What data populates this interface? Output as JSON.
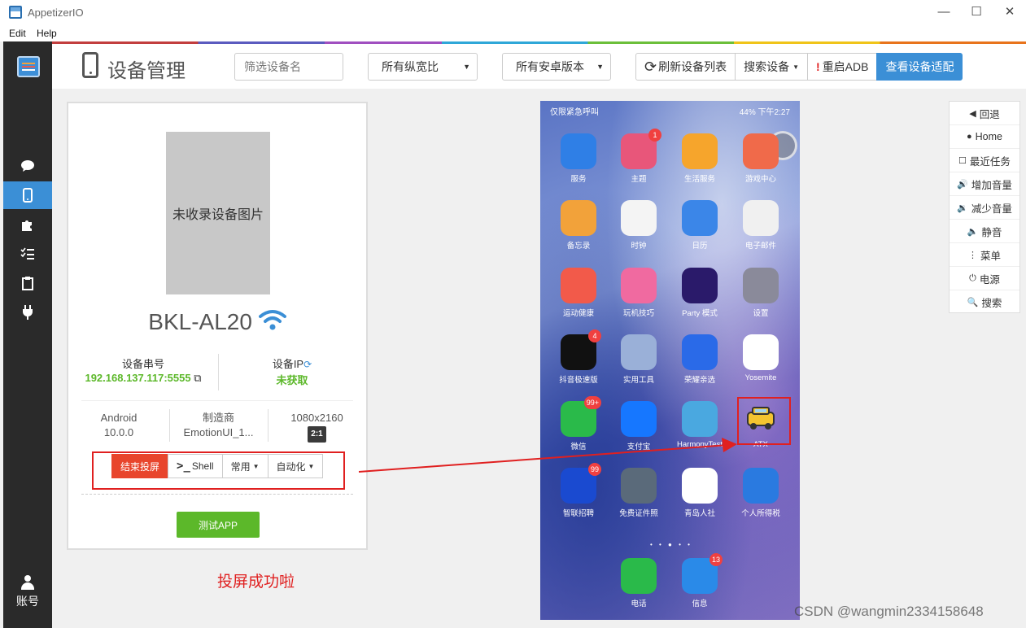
{
  "window": {
    "title": "AppetizerIO",
    "minimize": "—",
    "maximize": "☐",
    "close": "✕"
  },
  "menu": {
    "edit": "Edit",
    "help": "Help"
  },
  "sidebar": {
    "account_label": "账号"
  },
  "header": {
    "title": "设备管理",
    "filter_placeholder": "筛选设备名",
    "aspect_select": "所有纵宽比",
    "android_select": "所有安卓版本",
    "refresh_label": "刷新设备列表",
    "search_label": "搜索设备",
    "restart_adb_label": "重启ADB",
    "view_compat_label": "查看设备适配"
  },
  "device": {
    "no_image_text": "未收录设备图片",
    "model": "BKL-AL20",
    "serial_label": "设备串号",
    "serial_value": "192.168.137.117:5555",
    "ip_label": "设备IP",
    "ip_value": "未获取",
    "os_name": "Android",
    "os_version": "10.0.0",
    "maker_label": "制造商",
    "maker_value": "EmotionUI_1...",
    "resolution": "1080x2160",
    "ratio": "2:1",
    "end_cast_label": "结束投屏",
    "shell_label": "Shell",
    "shell_prompt": ">_",
    "common_label": "常用",
    "automation_label": "自动化",
    "test_app_label": "测试APP"
  },
  "annotation": {
    "success_text": "投屏成功啦"
  },
  "phone": {
    "status_left": "仅限紧急呼叫",
    "status_right": "44%  下午2:27",
    "apps": [
      {
        "label": "服务",
        "color": "#2f7fe6",
        "badge": ""
      },
      {
        "label": "主题",
        "color": "#e8567a",
        "badge": "1"
      },
      {
        "label": "生活服务",
        "color": "#f6a52c",
        "badge": ""
      },
      {
        "label": "游戏中心",
        "color": "#f06a4a",
        "badge": ""
      },
      {
        "label": "备忘录",
        "color": "#f2a23a",
        "badge": ""
      },
      {
        "label": "时钟",
        "color": "#f4f4f4",
        "badge": ""
      },
      {
        "label": "日历",
        "color": "#3b86e8",
        "badge": ""
      },
      {
        "label": "电子邮件",
        "color": "#f0f0f0",
        "badge": ""
      },
      {
        "label": "运动健康",
        "color": "#f25a4a",
        "badge": ""
      },
      {
        "label": "玩机技巧",
        "color": "#f06aa0",
        "badge": ""
      },
      {
        "label": "Party 模式",
        "color": "#2a1a6a",
        "badge": ""
      },
      {
        "label": "设置",
        "color": "#8a8a9a",
        "badge": ""
      },
      {
        "label": "抖音极速版",
        "color": "#111111",
        "badge": "4"
      },
      {
        "label": "实用工具",
        "color": "#9ab0d8",
        "badge": ""
      },
      {
        "label": "荣耀亲选",
        "color": "#2a6ae8",
        "badge": ""
      },
      {
        "label": "Yosemite",
        "color": "#ffffff",
        "badge": ""
      },
      {
        "label": "微信",
        "color": "#2aba4a",
        "badge": "99+"
      },
      {
        "label": "支付宝",
        "color": "#1677ff",
        "badge": ""
      },
      {
        "label": "HarmonyTest",
        "color": "#4aa8e0",
        "badge": ""
      },
      {
        "label": "ATX",
        "color": "transparent",
        "badge": ""
      },
      {
        "label": "智联招聘",
        "color": "#1a4ad0",
        "badge": "99"
      },
      {
        "label": "免费证件照",
        "color": "#5a6a7a",
        "badge": ""
      },
      {
        "label": "青岛人社",
        "color": "#ffffff",
        "badge": ""
      },
      {
        "label": "个人所得税",
        "color": "#2a7ae0",
        "badge": ""
      }
    ],
    "dock": [
      {
        "label": "电话",
        "color": "#2aba4a",
        "badge": ""
      },
      {
        "label": "信息",
        "color": "#2a8ae8",
        "badge": "13"
      }
    ]
  },
  "nav": [
    {
      "icon": "◀",
      "label": "回退",
      "name": "back"
    },
    {
      "icon": "●",
      "label": "Home",
      "name": "home"
    },
    {
      "icon": "☐",
      "label": "最近任务",
      "name": "recent-tasks"
    },
    {
      "icon": "🔊",
      "label": "增加音量",
      "name": "volume-up"
    },
    {
      "icon": "🔉",
      "label": "减少音量",
      "name": "volume-down"
    },
    {
      "icon": "🔈",
      "label": "静音",
      "name": "mute"
    },
    {
      "icon": "⋮",
      "label": "菜单",
      "name": "menu"
    },
    {
      "icon": "⏻",
      "label": "电源",
      "name": "power"
    },
    {
      "icon": "🔍",
      "label": "搜索",
      "name": "search"
    }
  ],
  "watermark": "CSDN @wangmin2334158648"
}
